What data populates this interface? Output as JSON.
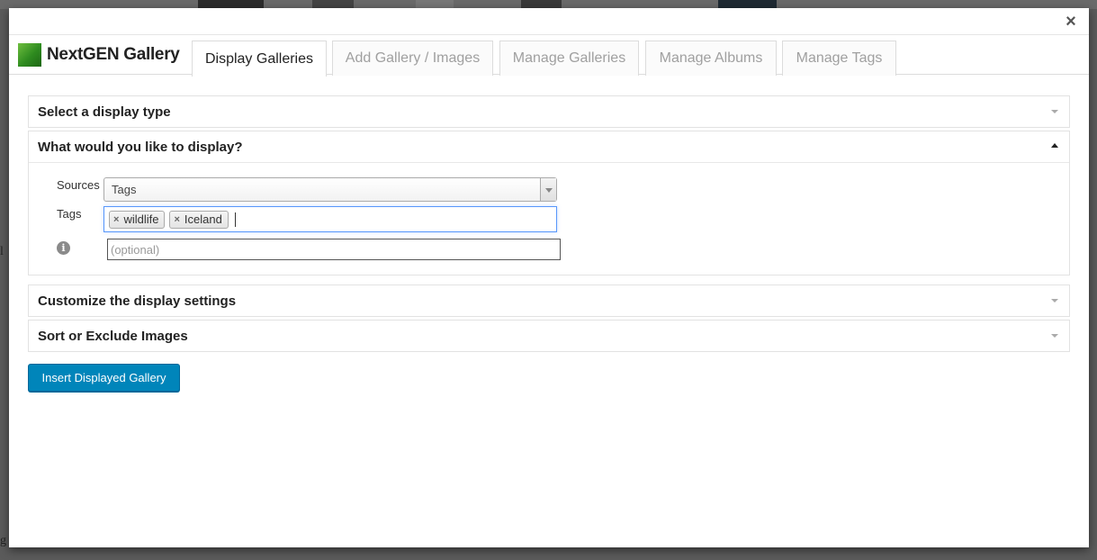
{
  "brand": {
    "name": "NextGEN Gallery"
  },
  "tabs": [
    {
      "label": "Display Galleries",
      "active": true
    },
    {
      "label": "Add Gallery / Images",
      "active": false
    },
    {
      "label": "Manage Galleries",
      "active": false
    },
    {
      "label": "Manage Albums",
      "active": false
    },
    {
      "label": "Manage Tags",
      "active": false
    }
  ],
  "panels": {
    "display_type": {
      "title": "Select a display type",
      "state": "collapsed"
    },
    "what_display": {
      "title": "What would you like to display?",
      "state": "expanded",
      "sources_label": "Sources",
      "sources_value": "Tags",
      "tags_label": "Tags",
      "tags": [
        "wildlife",
        "Iceland"
      ],
      "tag_remove_glyph": "×",
      "info_glyph": "i",
      "optional_placeholder": "(optional)"
    },
    "customize": {
      "title": "Customize the display settings",
      "state": "collapsed"
    },
    "sort": {
      "title": "Sort or Exclude Images",
      "state": "collapsed"
    }
  },
  "insert_button": "Insert Displayed Gallery",
  "close_glyph": "×",
  "colors": {
    "primary_button": "#0085ba",
    "focus_border": "#5897fb",
    "brand_green": "#3f9a2a"
  }
}
